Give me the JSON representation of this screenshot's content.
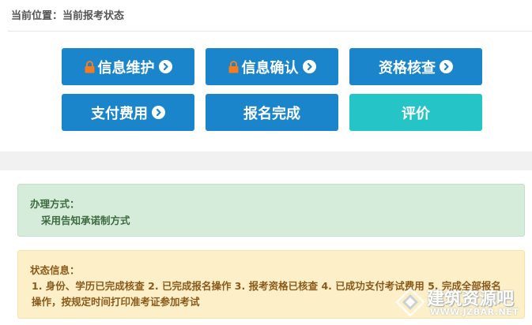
{
  "breadcrumb": {
    "text": "当前位置：当前报考状态"
  },
  "actions": [
    {
      "label": "信息维护",
      "locked": true,
      "arrow": true,
      "color": "#1b85cc"
    },
    {
      "label": "信息确认",
      "locked": true,
      "arrow": true,
      "color": "#1b85cc"
    },
    {
      "label": "资格核查",
      "locked": false,
      "arrow": true,
      "color": "#1b85cc"
    },
    {
      "label": "支付费用",
      "locked": false,
      "arrow": true,
      "color": "#1b85cc"
    },
    {
      "label": "报名完成",
      "locked": false,
      "arrow": false,
      "color": "#1b85cc"
    },
    {
      "label": "评价",
      "locked": false,
      "arrow": false,
      "color": "#24c4c7"
    }
  ],
  "icons": {
    "lock": "lock-icon",
    "arrow": "chevron-right-circle-icon"
  },
  "colors": {
    "primary": "#1b85cc",
    "accent": "#24c4c7",
    "lock": "#f47c20",
    "success_bg": "#d6ecdb",
    "warning_bg": "#fdf0c8"
  },
  "method_alert": {
    "title": "办理方式：",
    "body": "采用告知承诺制方式"
  },
  "status_alert": {
    "title": "状态信息：",
    "body": "1. 身份、学历已完成核查 2. 已完成报名操作 3. 报考资格已核查 4. 已成功支付考试费用 5. 完成全部报名操作，按规定时间打印准考证参加考试"
  },
  "watermark": {
    "name": "建筑资源吧",
    "url": "WWW.JZBAR.NET"
  }
}
